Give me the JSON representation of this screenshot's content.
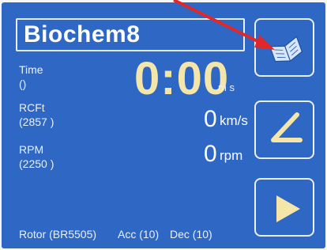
{
  "title": "Biochem8",
  "time": {
    "label": "Time",
    "sub": "()",
    "value": "0:00",
    "unit": "m s"
  },
  "rcf": {
    "label": "RCFt",
    "sub": "(2857 )",
    "value": "0",
    "unit": "km/s"
  },
  "rpm": {
    "label": "RPM",
    "sub": "(2250 )",
    "value": "0",
    "unit": "rpm"
  },
  "footer": {
    "rotor": "Rotor (BR5505)",
    "acc": "Acc (10)",
    "dec": "Dec (10)"
  },
  "buttons": {
    "top_icon": "book-icon",
    "mid_icon": "ramp-icon",
    "bottom_icon": "play-icon"
  },
  "colors": {
    "screen": "#2f67c4",
    "accent": "#f3e6a8",
    "arrow": "#e0282b"
  }
}
